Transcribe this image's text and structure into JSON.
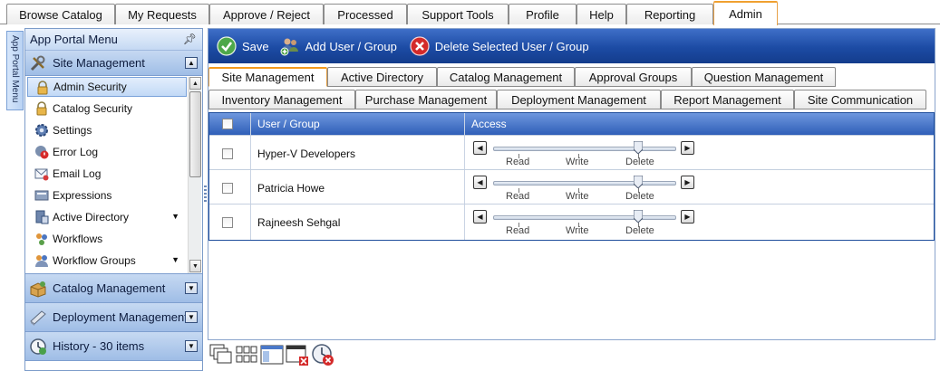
{
  "top_tabs": [
    {
      "label": "Browse Catalog",
      "active": false
    },
    {
      "label": "My Requests",
      "active": false
    },
    {
      "label": "Approve / Reject",
      "active": false
    },
    {
      "label": "Processed",
      "active": false
    },
    {
      "label": "Support Tools",
      "active": false
    },
    {
      "label": "Profile",
      "active": false
    },
    {
      "label": "Help",
      "active": false
    },
    {
      "label": "Reporting",
      "active": false
    },
    {
      "label": "Admin",
      "active": true
    }
  ],
  "side_strip": {
    "label": "App Portal Menu"
  },
  "menu": {
    "title": "App Portal Menu",
    "site_management": {
      "label": "Site Management",
      "items": [
        {
          "label": "Admin Security",
          "icon": "lock-icon",
          "selected": true
        },
        {
          "label": "Catalog Security",
          "icon": "lock-icon"
        },
        {
          "label": "Settings",
          "icon": "gear-icon"
        },
        {
          "label": "Error Log",
          "icon": "error-log-icon"
        },
        {
          "label": "Email Log",
          "icon": "email-log-icon"
        },
        {
          "label": "Expressions",
          "icon": "expressions-icon"
        },
        {
          "label": "Active Directory",
          "icon": "active-directory-icon",
          "has_submenu": true
        },
        {
          "label": "Workflows",
          "icon": "workflows-icon"
        },
        {
          "label": "Workflow Groups",
          "icon": "workflow-groups-icon",
          "has_submenu": true
        }
      ]
    },
    "catalog_management": {
      "label": "Catalog Management"
    },
    "deployment_management": {
      "label": "Deployment Management"
    },
    "history": {
      "label": "History - 30 items"
    }
  },
  "toolbar": {
    "save_label": "Save",
    "add_label": "Add User / Group",
    "delete_label": "Delete Selected User / Group"
  },
  "tabs_row1": [
    {
      "label": "Site Management",
      "active": true
    },
    {
      "label": "Active Directory"
    },
    {
      "label": "Catalog Management"
    },
    {
      "label": "Approval Groups"
    },
    {
      "label": "Question Management"
    }
  ],
  "tabs_row2": [
    {
      "label": "Inventory Management"
    },
    {
      "label": "Purchase Management"
    },
    {
      "label": "Deployment Management"
    },
    {
      "label": "Report Management"
    },
    {
      "label": "Site Communication"
    }
  ],
  "grid": {
    "headers": {
      "user": "User / Group",
      "access": "Access"
    },
    "access_levels": [
      "Read",
      "Write",
      "Delete"
    ],
    "rows": [
      {
        "name": "Hyper-V Developers",
        "access_level": "Delete",
        "checked": false
      },
      {
        "name": "Patricia Howe",
        "access_level": "Delete",
        "checked": false
      },
      {
        "name": "Rajneesh Sehgal",
        "access_level": "Delete",
        "checked": false
      }
    ]
  },
  "bottom_icons": [
    "cascade-windows-icon",
    "tile-windows-icon",
    "window-icon",
    "close-window-icon",
    "close-all-icon"
  ],
  "colors": {
    "toolbar": "#1c4ba4",
    "active_tab_accent": "#f39a1e",
    "grid_header": "#2f5fb8",
    "menu_section": "#9fbde6"
  }
}
